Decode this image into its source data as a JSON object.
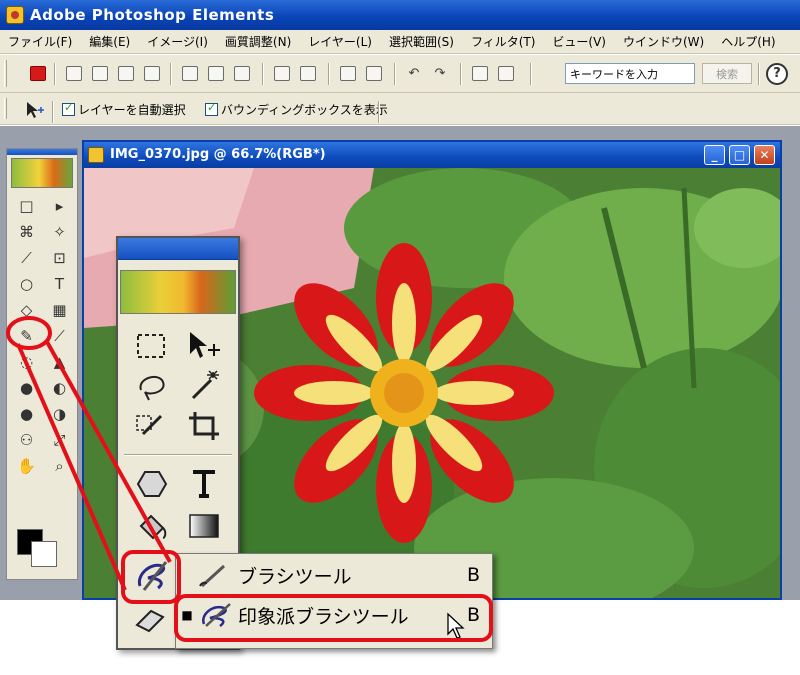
{
  "window": {
    "title": "Adobe Photoshop Elements"
  },
  "menubar": {
    "items": [
      "ファイル(F)",
      "編集(E)",
      "イメージ(I)",
      "画質調整(N)",
      "レイヤー(L)",
      "選択範囲(S)",
      "フィルタ(T)",
      "ビュー(V)",
      "ウインドウ(W)",
      "ヘルプ(H)"
    ]
  },
  "toolbar": {
    "search_placeholder": "キーワードを入力",
    "search_button": "検索",
    "help_glyph": "?"
  },
  "options_bar": {
    "auto_select_label": "レイヤーを自動選択",
    "bounding_box_label": "バウンディングボックスを表示",
    "auto_select_checked": true,
    "bounding_box_checked": true
  },
  "document": {
    "title": "IMG_0370.jpg @ 66.7%(RGB*)",
    "buttons": {
      "minimize": "_",
      "maximize": "□",
      "close": "✕"
    }
  },
  "toolbox": {
    "small_tools": [
      "□",
      "▸",
      "⌘",
      "✧",
      "⟋",
      "⊡",
      "○",
      "T",
      "◇",
      "▦",
      "✎",
      "⟋",
      "◌",
      "▲",
      "●",
      "◐",
      "●",
      "◑",
      "⚇",
      "⤢",
      "✋",
      "⌕"
    ]
  },
  "flyout": {
    "items": [
      {
        "label": "ブラシツール",
        "shortcut": "B",
        "selected": false
      },
      {
        "label": "印象派ブラシツール",
        "shortcut": "B",
        "selected": true
      }
    ],
    "bullet": "■"
  },
  "colors": {
    "title_bar": "#0a45b8",
    "chrome": "#ece9d8",
    "highlight": "#e3101a",
    "foreground": "#000000",
    "background": "#ffffff"
  }
}
